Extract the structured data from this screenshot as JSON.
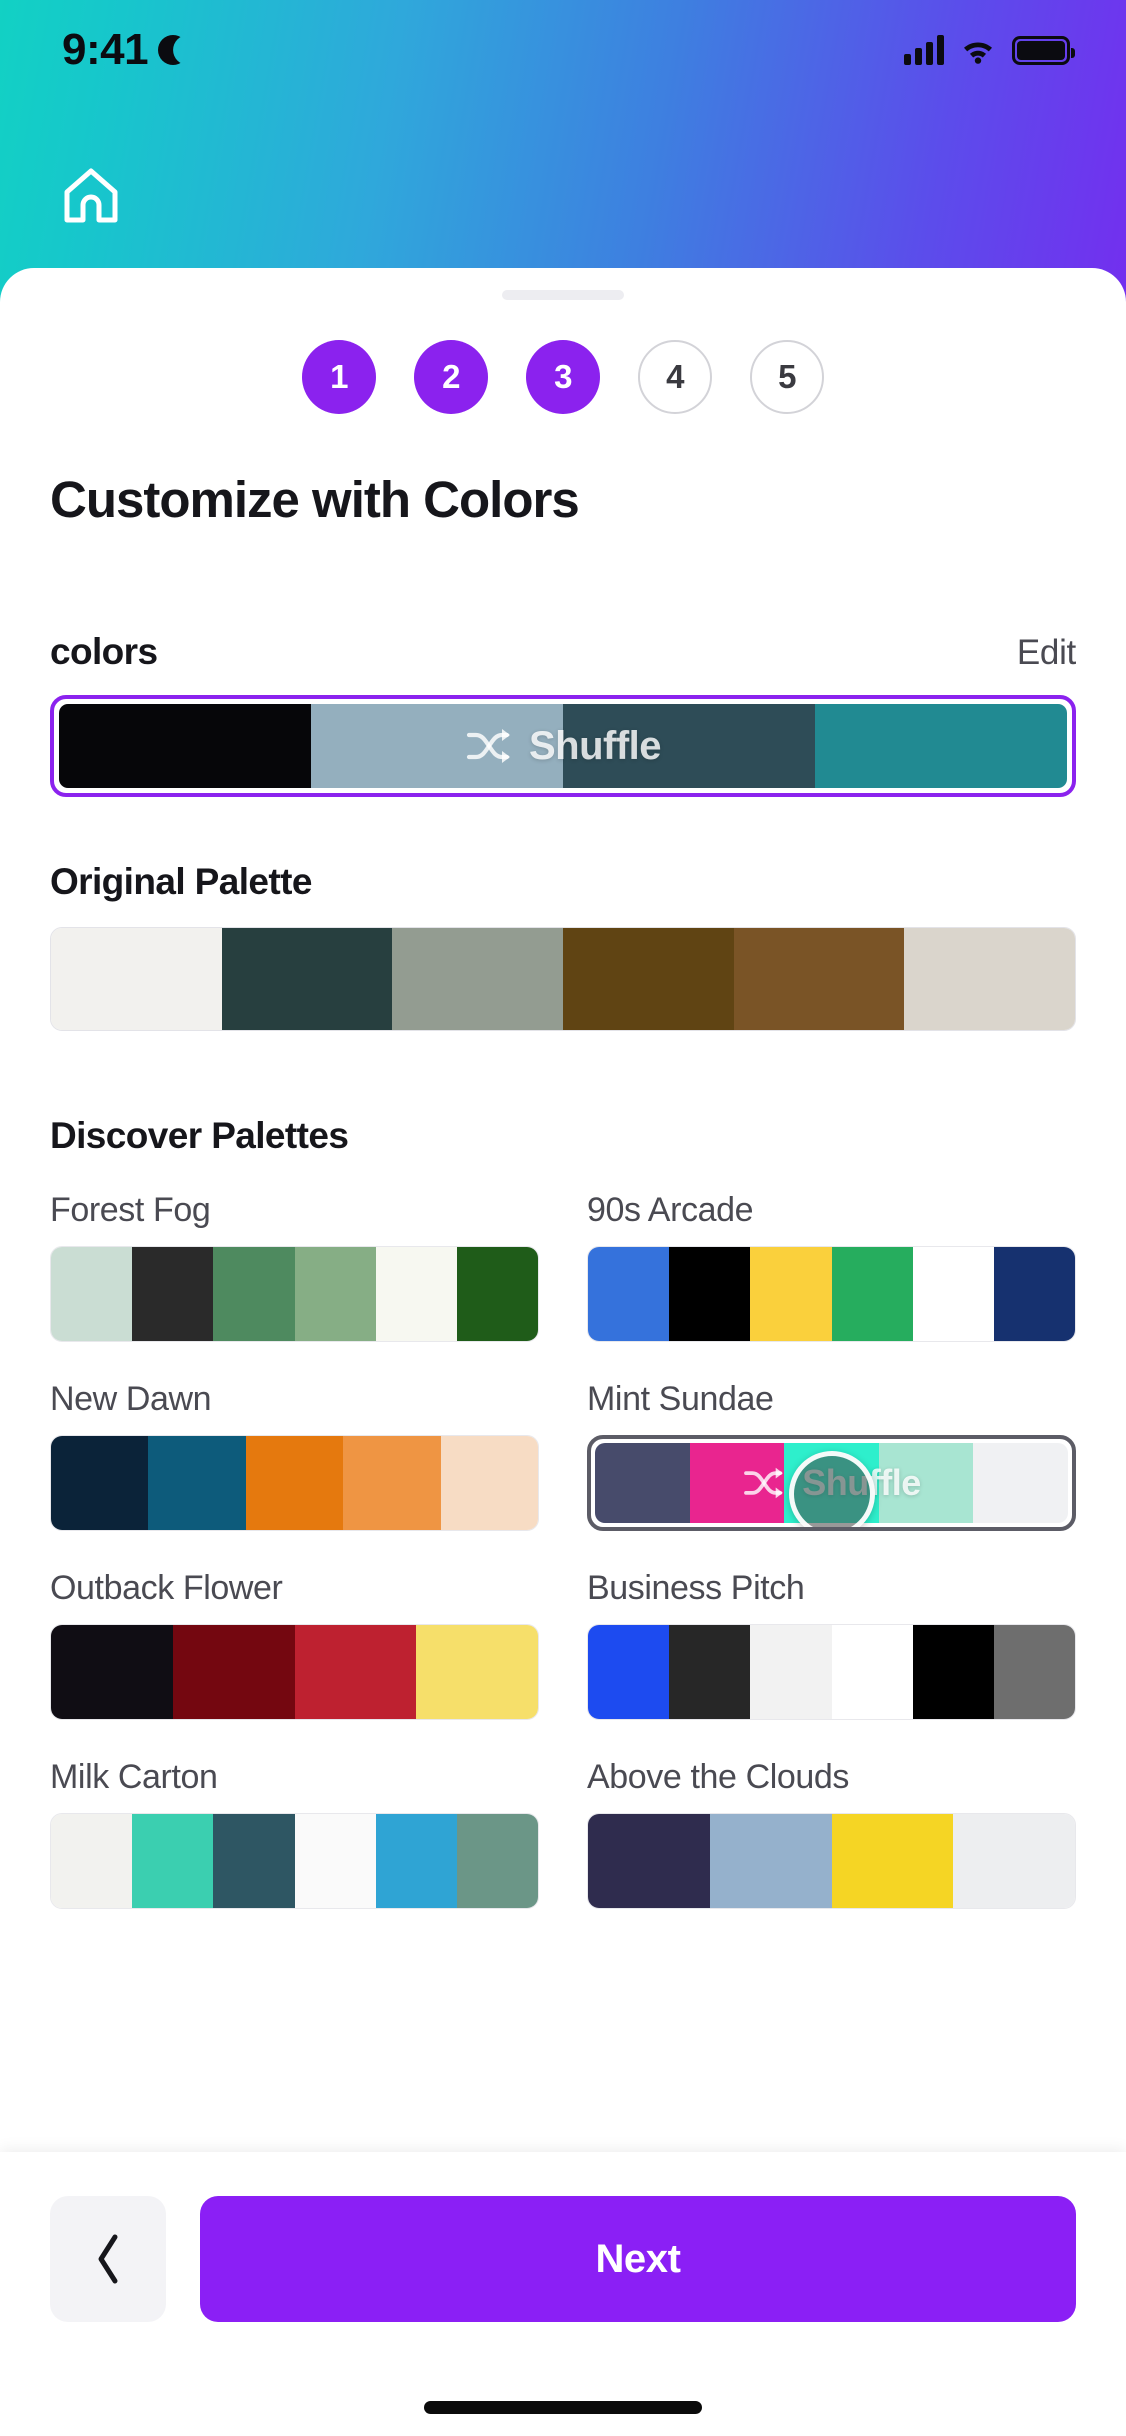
{
  "status_bar": {
    "time": "9:41",
    "dnd_icon": "moon-icon",
    "signal_icon": "cellular-signal-icon",
    "wifi_icon": "wifi-icon",
    "battery_icon": "battery-full-icon"
  },
  "header": {
    "home_icon": "home-icon"
  },
  "sheet": {
    "grabber": "drag-handle"
  },
  "steps": [
    {
      "label": "1",
      "state": "done"
    },
    {
      "label": "2",
      "state": "done"
    },
    {
      "label": "3",
      "state": "done"
    },
    {
      "label": "4",
      "state": "todo"
    },
    {
      "label": "5",
      "state": "todo"
    }
  ],
  "page_title": "Customize with Colors",
  "colors_section": {
    "label": "colors",
    "edit_label": "Edit",
    "shuffle_label": "Shuffle",
    "shuffle_icon": "shuffle-icon",
    "selected_swatches": [
      "#060609",
      "#94AFBE",
      "#2E4C57",
      "#218A92"
    ]
  },
  "original_palette": {
    "title": "Original Palette",
    "swatches": [
      "#F2F1EE",
      "#273F3F",
      "#939C91",
      "#604413",
      "#7A5426",
      "#DAD5CC"
    ]
  },
  "discover": {
    "title": "Discover Palettes",
    "shuffle_label": "Shuffle",
    "palettes": [
      {
        "name": "Forest Fog",
        "active": false,
        "swatches": [
          "#CADDD3",
          "#2A2A2A",
          "#4E8A5F",
          "#86AE85",
          "#F7F8F1",
          "#1F5C19"
        ]
      },
      {
        "name": "90s Arcade",
        "active": false,
        "swatches": [
          "#3572DC",
          "#000000",
          "#FAD03C",
          "#26AD5E",
          "#FFFFFF",
          "#16316F"
        ]
      },
      {
        "name": "New Dawn",
        "active": false,
        "swatches": [
          "#0B2339",
          "#0D5B7B",
          "#E5790E",
          "#EF9543",
          "#F7DCC4"
        ]
      },
      {
        "name": "Mint Sundae",
        "active": true,
        "swatches": [
          "#474B6B",
          "#E9258F",
          "#2EEFCC",
          "#A8E5D2",
          "#F0F1F3"
        ]
      },
      {
        "name": "Outback Flower",
        "active": false,
        "swatches": [
          "#100D14",
          "#740710",
          "#BE2130",
          "#F6DF6A"
        ]
      },
      {
        "name": "Business Pitch",
        "active": false,
        "swatches": [
          "#1D4BF0",
          "#272727",
          "#F2F2F2",
          "#FFFFFF",
          "#000000",
          "#6E6E6E"
        ]
      },
      {
        "name": "Milk Carton",
        "active": false,
        "swatches": [
          "#F2F2EF",
          "#3BCFB0",
          "#2E5663",
          "#FAFAFA",
          "#2FA4D4",
          "#6B9687"
        ]
      },
      {
        "name": "Above the Clouds",
        "active": false,
        "swatches": [
          "#2F2C4E",
          "#95B1CC",
          "#F5D524",
          "#EDEEF0"
        ]
      }
    ]
  },
  "bottom_bar": {
    "back_icon": "chevron-left-icon",
    "next_label": "Next"
  },
  "theme": {
    "accent_purple": "#8B1FF5",
    "step_purple": "#8B22EE",
    "gradient_start": "#12D1C4",
    "gradient_end": "#8A12F2"
  }
}
